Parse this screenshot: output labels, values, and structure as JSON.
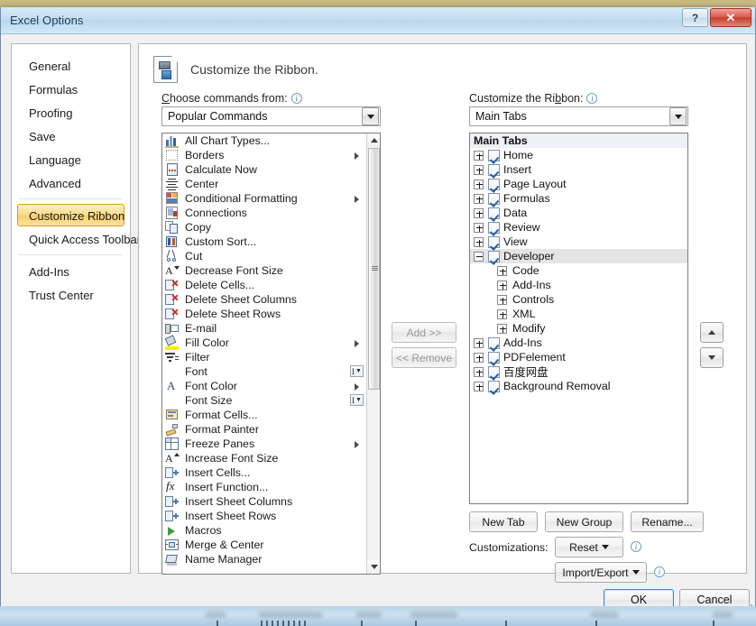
{
  "window": {
    "title": "Excel Options",
    "help_button": "?",
    "close_button": "✕"
  },
  "sidebar": {
    "items": [
      {
        "label": "General",
        "selected": false
      },
      {
        "label": "Formulas",
        "selected": false
      },
      {
        "label": "Proofing",
        "selected": false
      },
      {
        "label": "Save",
        "selected": false
      },
      {
        "label": "Language",
        "selected": false
      },
      {
        "label": "Advanced",
        "selected": false
      },
      {
        "label": "Customize Ribbon",
        "selected": true
      },
      {
        "label": "Quick Access Toolbar",
        "selected": false
      },
      {
        "label": "Add-Ins",
        "selected": false
      },
      {
        "label": "Trust Center",
        "selected": false
      }
    ]
  },
  "header": {
    "title": "Customize the Ribbon.",
    "icon": "customize-ribbon-icon"
  },
  "left_pane": {
    "label": "Choose commands from:",
    "label_underline_char": "C",
    "info_icon": "info-icon",
    "combo_value": "Popular Commands",
    "commands": [
      {
        "label": "All Chart Types...",
        "icon": "chart-icon",
        "submenu": false,
        "ibeam": false
      },
      {
        "label": "Borders",
        "icon": "borders-icon",
        "submenu": true,
        "ibeam": false
      },
      {
        "label": "Calculate Now",
        "icon": "calculator-icon",
        "submenu": false,
        "ibeam": false
      },
      {
        "label": "Center",
        "icon": "align-center-icon",
        "submenu": false,
        "ibeam": false
      },
      {
        "label": "Conditional Formatting",
        "icon": "conditional-format-icon",
        "submenu": true,
        "ibeam": false
      },
      {
        "label": "Connections",
        "icon": "connections-icon",
        "submenu": false,
        "ibeam": false
      },
      {
        "label": "Copy",
        "icon": "copy-icon",
        "submenu": false,
        "ibeam": false
      },
      {
        "label": "Custom Sort...",
        "icon": "sort-icon",
        "submenu": false,
        "ibeam": false
      },
      {
        "label": "Cut",
        "icon": "scissors-icon",
        "submenu": false,
        "ibeam": false
      },
      {
        "label": "Decrease Font Size",
        "icon": "decrease-font-size-icon",
        "submenu": false,
        "ibeam": false
      },
      {
        "label": "Delete Cells...",
        "icon": "delete-cells-icon",
        "submenu": false,
        "ibeam": false
      },
      {
        "label": "Delete Sheet Columns",
        "icon": "delete-sheet-columns-icon",
        "submenu": false,
        "ibeam": false
      },
      {
        "label": "Delete Sheet Rows",
        "icon": "delete-sheet-rows-icon",
        "submenu": false,
        "ibeam": false
      },
      {
        "label": "E-mail",
        "icon": "email-icon",
        "submenu": false,
        "ibeam": false
      },
      {
        "label": "Fill Color",
        "icon": "fill-color-icon",
        "submenu": true,
        "ibeam": false
      },
      {
        "label": "Filter",
        "icon": "filter-icon",
        "submenu": false,
        "ibeam": false
      },
      {
        "label": "Font",
        "icon": "none",
        "submenu": false,
        "ibeam": true
      },
      {
        "label": "Font Color",
        "icon": "font-color-icon",
        "submenu": true,
        "ibeam": false
      },
      {
        "label": "Font Size",
        "icon": "none",
        "submenu": false,
        "ibeam": true
      },
      {
        "label": "Format Cells...",
        "icon": "format-cells-icon",
        "submenu": false,
        "ibeam": false
      },
      {
        "label": "Format Painter",
        "icon": "format-painter-icon",
        "submenu": false,
        "ibeam": false
      },
      {
        "label": "Freeze Panes",
        "icon": "freeze-panes-icon",
        "submenu": true,
        "ibeam": false
      },
      {
        "label": "Increase Font Size",
        "icon": "increase-font-size-icon",
        "submenu": false,
        "ibeam": false
      },
      {
        "label": "Insert Cells...",
        "icon": "insert-cells-icon",
        "submenu": false,
        "ibeam": false
      },
      {
        "label": "Insert Function...",
        "icon": "insert-function-icon",
        "submenu": false,
        "ibeam": false
      },
      {
        "label": "Insert Sheet Columns",
        "icon": "insert-sheet-columns-icon",
        "submenu": false,
        "ibeam": false
      },
      {
        "label": "Insert Sheet Rows",
        "icon": "insert-sheet-rows-icon",
        "submenu": false,
        "ibeam": false
      },
      {
        "label": "Macros",
        "icon": "macros-icon",
        "submenu": false,
        "ibeam": false
      },
      {
        "label": "Merge & Center",
        "icon": "merge-center-icon",
        "submenu": false,
        "ibeam": false
      },
      {
        "label": "Name Manager",
        "icon": "name-manager-icon",
        "submenu": false,
        "ibeam": false
      }
    ]
  },
  "transfer": {
    "add_label": "Add >>",
    "remove_label": "<< Remove",
    "add_enabled": false,
    "remove_enabled": false
  },
  "right_pane": {
    "label": "Customize the Ribbon:",
    "label_underline_char": "b",
    "info_icon": "info-icon",
    "combo_value": "Main Tabs",
    "tree_header": "Main Tabs",
    "tree": [
      {
        "label": "Home",
        "indent": 0,
        "expander": "plus",
        "checkbox": true,
        "selected": false
      },
      {
        "label": "Insert",
        "indent": 0,
        "expander": "plus",
        "checkbox": true,
        "selected": false
      },
      {
        "label": "Page Layout",
        "indent": 0,
        "expander": "plus",
        "checkbox": true,
        "selected": false
      },
      {
        "label": "Formulas",
        "indent": 0,
        "expander": "plus",
        "checkbox": true,
        "selected": false
      },
      {
        "label": "Data",
        "indent": 0,
        "expander": "plus",
        "checkbox": true,
        "selected": false
      },
      {
        "label": "Review",
        "indent": 0,
        "expander": "plus",
        "checkbox": true,
        "selected": false
      },
      {
        "label": "View",
        "indent": 0,
        "expander": "plus",
        "checkbox": true,
        "selected": false
      },
      {
        "label": "Developer",
        "indent": 0,
        "expander": "minus",
        "checkbox": true,
        "selected": true
      },
      {
        "label": "Code",
        "indent": 1,
        "expander": "plus",
        "checkbox": false,
        "selected": false
      },
      {
        "label": "Add-Ins",
        "indent": 1,
        "expander": "plus",
        "checkbox": false,
        "selected": false
      },
      {
        "label": "Controls",
        "indent": 1,
        "expander": "plus",
        "checkbox": false,
        "selected": false
      },
      {
        "label": "XML",
        "indent": 1,
        "expander": "plus",
        "checkbox": false,
        "selected": false
      },
      {
        "label": "Modify",
        "indent": 1,
        "expander": "plus",
        "checkbox": false,
        "selected": false
      },
      {
        "label": "Add-Ins",
        "indent": 0,
        "expander": "plus",
        "checkbox": true,
        "selected": false
      },
      {
        "label": "PDFelement",
        "indent": 0,
        "expander": "plus",
        "checkbox": true,
        "selected": false
      },
      {
        "label": "百度网盘",
        "indent": 0,
        "expander": "plus",
        "checkbox": true,
        "selected": false
      },
      {
        "label": "Background Removal",
        "indent": 0,
        "expander": "plus",
        "checkbox": true,
        "selected": false
      }
    ],
    "move_up_icon": "arrow-up-icon",
    "move_down_icon": "arrow-down-icon"
  },
  "actions": {
    "new_tab": "New Tab",
    "new_group": "New Group",
    "rename": "Rename...",
    "customizations_label": "Customizations:",
    "reset": "Reset",
    "import_export": "Import/Export"
  },
  "footer": {
    "ok": "OK",
    "cancel": "Cancel"
  }
}
